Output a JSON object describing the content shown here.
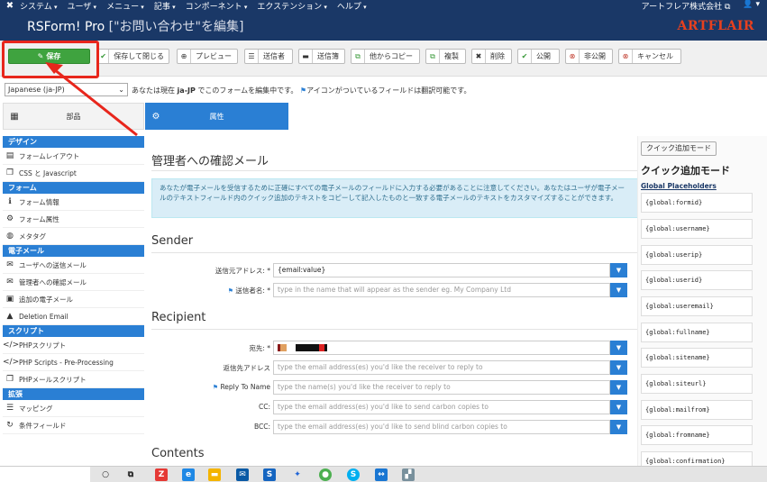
{
  "topbar": {
    "menu": [
      "システム",
      "ユーザ",
      "メニュー",
      "記事",
      "コンポーネント",
      "エクステンション",
      "ヘルプ"
    ],
    "site_name": "アートフレア株式会社 ⧉",
    "user_label": "👤 ▾"
  },
  "header": {
    "title": "RSForm! Pro",
    "subtitle": "[\"お問い合わせ\"を編集]",
    "logo_text": "ARTFLAIR"
  },
  "toolbar": {
    "save": "保存",
    "save_close": "保存して閉じる",
    "preview": "プレビュー",
    "submitters": "送信者",
    "submissions": "送信簿",
    "copy_from": "他からコピー",
    "duplicate": "複製",
    "delete": "削除",
    "publish": "公開",
    "unpublish": "非公開",
    "cancel": "キャンセル"
  },
  "language": {
    "selected": "Japanese (ja-JP)",
    "message_prefix": "あなたは現在",
    "message_lang": "ja-JP",
    "message_suffix": "でこのフォームを編集中です。",
    "flag_note": "アイコンがついているフィールドは翻訳可能です。"
  },
  "tabs": {
    "components": "部品",
    "properties": "属性"
  },
  "sidebar": {
    "sections": [
      {
        "title": "デザイン",
        "items": [
          {
            "label": "フォームレイアウト",
            "icon": "layout-icon"
          },
          {
            "label": "CSS と Javascript",
            "icon": "code-icon"
          }
        ]
      },
      {
        "title": "フォーム",
        "items": [
          {
            "label": "フォーム情報",
            "icon": "info-icon"
          },
          {
            "label": "フォーム属性",
            "icon": "cogs-icon"
          },
          {
            "label": "メタタグ",
            "icon": "globe-icon"
          }
        ]
      },
      {
        "title": "電子メール",
        "items": [
          {
            "label": "ユーザへの送信メール",
            "icon": "envelope-icon"
          },
          {
            "label": "管理者への確認メール",
            "icon": "envelope-filled-icon"
          },
          {
            "label": "追加の電子メール",
            "icon": "mail-plus-icon"
          },
          {
            "label": "Deletion Email",
            "icon": "user-icon"
          }
        ]
      },
      {
        "title": "スクリプト",
        "items": [
          {
            "label": "PHPスクリプト",
            "icon": "code-icon"
          },
          {
            "label": "PHP Scripts - Pre-Processing",
            "icon": "code-icon"
          },
          {
            "label": "PHPメールスクリプト",
            "icon": "file-code-icon"
          }
        ]
      },
      {
        "title": "拡張",
        "items": [
          {
            "label": "マッピング",
            "icon": "database-icon"
          },
          {
            "label": "条件フィールド",
            "icon": "refresh-icon"
          }
        ]
      }
    ]
  },
  "main": {
    "title": "管理者への確認メール",
    "info": "あなたが電子メールを受信するために正確にすべての電子メールのフィールドに入力する必要があることに注意してください。あなたはユーザが電子メールのテキストフィールド内のクイック追加のテキストをコピーして記入したものと一致する電子メールのテキストをカスタマイズすることができます。",
    "sender_heading": "Sender",
    "from_label": "送信元アドレス:",
    "from_value": "{email:value}",
    "from_name_label": "送信者名:",
    "from_name_placeholder": "type in the name that will appear as the sender eg. My Company Ltd",
    "recipient_heading": "Recipient",
    "to_label": "宛先:",
    "replyto_label": "返信先アドレス",
    "replyto_placeholder": "type the email address(es) you'd like the receiver to reply to",
    "replytoname_label": "Reply To Name",
    "replytoname_placeholder": "type the name(s) you'd like the receiver to reply to",
    "cc_label": "CC:",
    "cc_placeholder": "type the email address(es) you'd like to send carbon copies to",
    "bcc_label": "BCC:",
    "bcc_placeholder": "type the email address(es) you'd like to send blind carbon copies to",
    "contents_heading": "Contents",
    "required_mark": "*"
  },
  "quick_add": {
    "button": "クイック追加モード",
    "title": "クイック追加モード",
    "global_link": "Global Placeholders",
    "placeholders": [
      "{global:formid}",
      "{global:username}",
      "{global:userip}",
      "{global:userid}",
      "{global:useremail}",
      "{global:fullname}",
      "{global:sitename}",
      "{global:siteurl}",
      "{global:mailfrom}",
      "{global:fromname}",
      "{global:confirmation}"
    ]
  },
  "colors": {
    "header": "#1a3867",
    "accent": "#2a7fd4",
    "save": "#3fa33f",
    "highlight": "#e8261c"
  }
}
